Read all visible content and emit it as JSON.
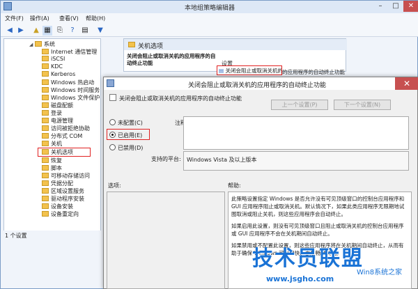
{
  "window": {
    "title": "本地组策略编辑器"
  },
  "menubar": [
    "文件(F)",
    "操作(A)",
    "查看(V)",
    "帮助(H)"
  ],
  "tree": {
    "items": [
      {
        "label": "系统",
        "open": true
      },
      {
        "label": "Internet 通信管理"
      },
      {
        "label": "iSCSI"
      },
      {
        "label": "KDC"
      },
      {
        "label": "Kerberos"
      },
      {
        "label": "Windows 热启动"
      },
      {
        "label": "Windows 时间服务"
      },
      {
        "label": "Windows 文件保护"
      },
      {
        "label": "磁盘配额"
      },
      {
        "label": "登录"
      },
      {
        "label": "电源管理"
      },
      {
        "label": "访问被拒绝协助"
      },
      {
        "label": "分布式 COM"
      },
      {
        "label": "关机"
      },
      {
        "label": "关机选项",
        "selected": true
      },
      {
        "label": "恢复"
      },
      {
        "label": "脚本"
      },
      {
        "label": "可移动存储访问"
      },
      {
        "label": "凭据分配"
      },
      {
        "label": "区域设置服务"
      },
      {
        "label": "驱动程序安装"
      },
      {
        "label": "设备安装"
      },
      {
        "label": "设备重定向"
      }
    ]
  },
  "status": "1 个设置",
  "right_pane": {
    "header": "关机选项",
    "desc_title": "关闭会阻止或取消关机的应用程序的自动终止功能",
    "col_setting": "设置",
    "setting_item": "关闭会阻止或取消关机的应用程序的自动终止功能"
  },
  "dialog": {
    "title": "关闭会阻止或取消关机的应用程序的自动终止功能",
    "subtitle": "关闭会阻止或取消关机的应用程序的自动终止功能",
    "prev_button": "上一个设置(P)",
    "next_button": "下一个设置(N)",
    "radio_not_configured": "未配置(C)",
    "radio_enabled": "已启用(E)",
    "radio_disabled": "已禁用(D)",
    "comment_label": "注释:",
    "platform_label": "支持的平台:",
    "platform_value": "Windows Vista 及以上版本",
    "options_label": "选项:",
    "help_label": "帮助:",
    "help_p1": "此策略设置指定 Windows 是否允许没有可见顶级窗口的控制台应用程序和 GUI 应用程序阻止或取消关机。默认情况下，如果此类应用程序无限期地试图取消或阻止关机，则这些应用程序会自动终止。",
    "help_p2": "如果启用此设置，则没有可见顶级窗口且阻止或取消关机的控制台应用程序或 GUI 应用程序不会在关机期间自动终止。",
    "help_p3": "如果禁用或不配置此设置，则这些应用程序将在关机期间自动终止，从而有助于确保 Windows 可以更快、更顺畅地关机。"
  },
  "watermark": {
    "brand": "技术员联盟",
    "sub": "Win8系统之家",
    "url": "www.jsgho.com"
  }
}
